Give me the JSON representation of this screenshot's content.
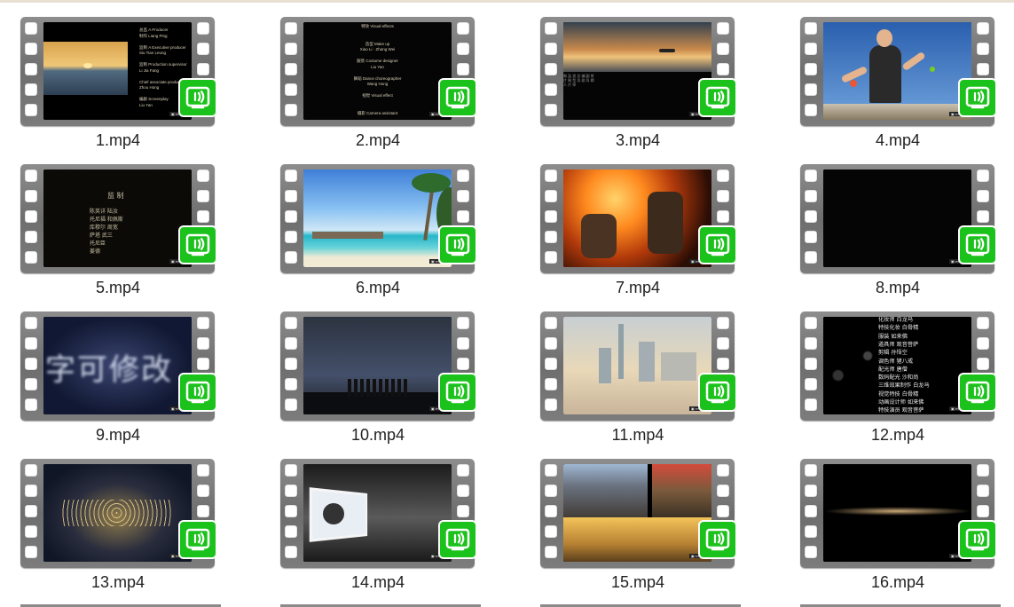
{
  "files": [
    {
      "name": "1.mp4"
    },
    {
      "name": "2.mp4"
    },
    {
      "name": "3.mp4"
    },
    {
      "name": "4.mp4"
    },
    {
      "name": "5.mp4"
    },
    {
      "name": "6.mp4"
    },
    {
      "name": "7.mp4"
    },
    {
      "name": "8.mp4"
    },
    {
      "name": "9.mp4"
    },
    {
      "name": "10.mp4"
    },
    {
      "name": "11.mp4"
    },
    {
      "name": "12.mp4"
    },
    {
      "name": "13.mp4"
    },
    {
      "name": "14.mp4"
    },
    {
      "name": "15.mp4"
    },
    {
      "name": "16.mp4"
    }
  ],
  "thumb_text": {
    "t5_title": "监 制",
    "t5_lines": [
      "陈英详   陆汝",
      "托尼福   和佩斯",
      "库穆尔   周宽",
      "萨塔   武三",
      "托尼臣",
      "姜德"
    ],
    "t9_text": "字可修改",
    "t12_lines": [
      "化妆师   白龙马",
      "特技化妆   白骨精",
      "服装   如来佛",
      "道具师   观音菩萨",
      "剪辑   孙悟空",
      "调色师   猪八戒",
      "配光师   唐僧",
      "数码配光   沙和尚",
      "三维效果制作   白龙马",
      "视觉特技   白骨精",
      "动画设计师   如来佛",
      "特技演员   观音菩萨"
    ]
  },
  "icon_names": {
    "badge": "video-file-badge-icon"
  },
  "colors": {
    "badge": "#1cc21c",
    "filmstrip": "#7d7d7d",
    "label": "#222222"
  }
}
